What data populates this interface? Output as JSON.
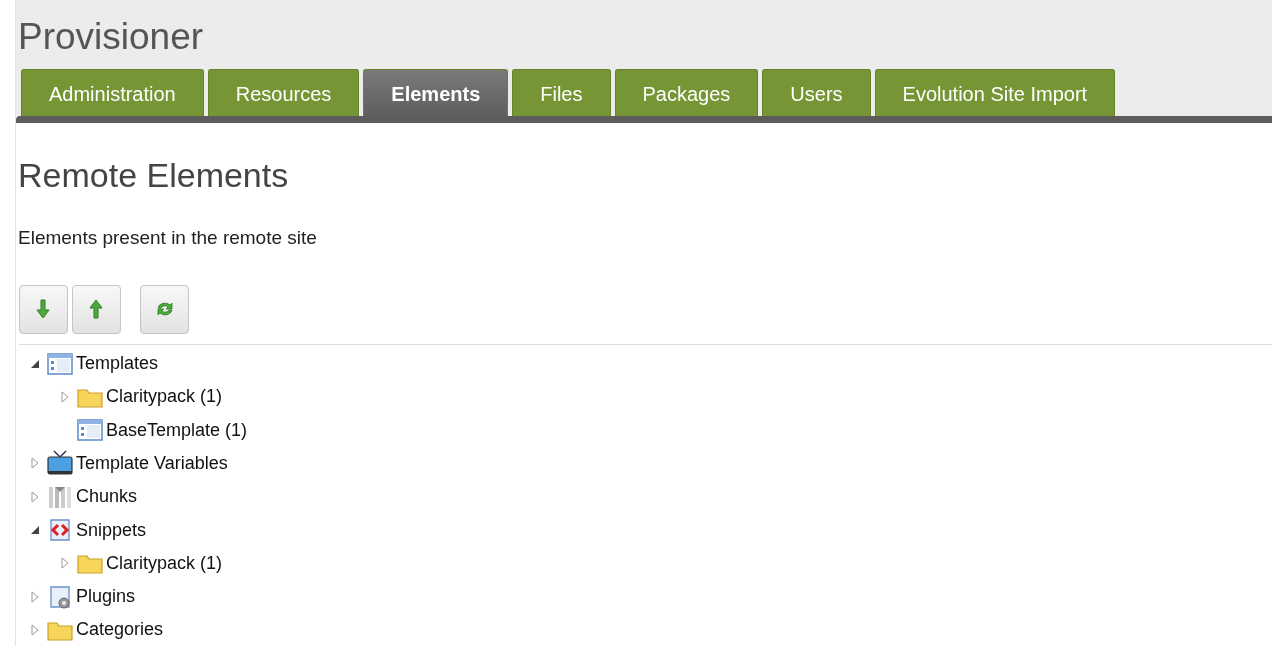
{
  "header": {
    "title": "Provisioner"
  },
  "tabs": [
    {
      "label": "Administration",
      "selected": false
    },
    {
      "label": "Resources",
      "selected": false
    },
    {
      "label": "Elements",
      "selected": true
    },
    {
      "label": "Files",
      "selected": false
    },
    {
      "label": "Packages",
      "selected": false
    },
    {
      "label": "Users",
      "selected": false
    },
    {
      "label": "Evolution Site Import",
      "selected": false
    }
  ],
  "panel": {
    "heading": "Remote Elements",
    "description": "Elements present in the remote site"
  },
  "toolbar": [
    {
      "kind": "down"
    },
    {
      "kind": "up"
    },
    {
      "kind": "refresh"
    }
  ],
  "tree": [
    {
      "label": "Templates",
      "kind": "template",
      "expanded": true,
      "children": [
        {
          "label": "Claritypack (1)",
          "kind": "folder",
          "expanded": false
        },
        {
          "label": "BaseTemplate (1)",
          "kind": "template"
        }
      ]
    },
    {
      "label": "Template Variables",
      "kind": "tv",
      "expanded": false
    },
    {
      "label": "Chunks",
      "kind": "chunk",
      "expanded": false
    },
    {
      "label": "Snippets",
      "kind": "snippet",
      "expanded": true,
      "children": [
        {
          "label": "Claritypack (1)",
          "kind": "folder",
          "expanded": false
        }
      ]
    },
    {
      "label": "Plugins",
      "kind": "plugin",
      "expanded": false
    },
    {
      "label": "Categories",
      "kind": "folder",
      "expanded": false
    }
  ]
}
